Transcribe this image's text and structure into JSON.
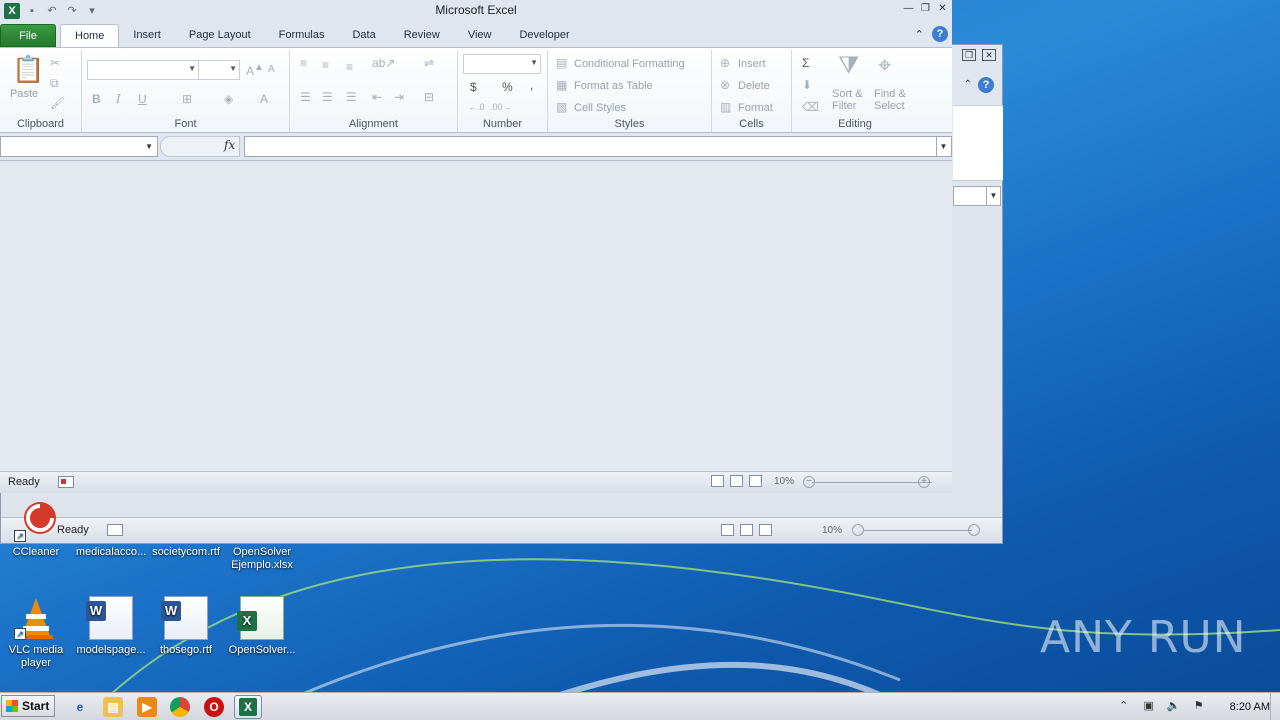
{
  "window": {
    "title": "Microsoft Excel"
  },
  "tabs": [
    "File",
    "Home",
    "Insert",
    "Page Layout",
    "Formulas",
    "Data",
    "Review",
    "View",
    "Developer"
  ],
  "ribbon": {
    "clipboard": {
      "paste": "Paste",
      "label": "Clipboard"
    },
    "font": {
      "label": "Font",
      "bold": "B",
      "italic": "I",
      "underline": "U"
    },
    "alignment": {
      "label": "Alignment"
    },
    "number": {
      "label": "Number",
      "currency": "$",
      "percent": "%",
      "comma": ","
    },
    "styles": {
      "label": "Styles",
      "conditional": "Conditional Formatting",
      "format_table": "Format as Table",
      "cell_styles": "Cell Styles"
    },
    "cells": {
      "label": "Cells",
      "insert": "Insert",
      "delete": "Delete",
      "format": "Format"
    },
    "editing": {
      "label": "Editing",
      "sort1": "Sort &",
      "sort2": "Filter",
      "find1": "Find &",
      "find2": "Select",
      "sigma": "Σ"
    }
  },
  "formula_bar": {
    "fx": "fx",
    "name_value": "",
    "formula_value": ""
  },
  "status": {
    "ready": "Ready",
    "zoom": "10%"
  },
  "back_window": {
    "ready": "Ready",
    "zoom": "10%"
  },
  "desktop_icons": [
    {
      "label": "CCleaner"
    },
    {
      "label": "medicalacco..."
    },
    {
      "label": "societycom.rtf"
    },
    {
      "label": "OpenSolver Ejemplo.xlsx"
    },
    {
      "label": "VLC media player"
    },
    {
      "label": "modelspage..."
    },
    {
      "label": "thosego.rtf"
    },
    {
      "label": "OpenSolver..."
    }
  ],
  "taskbar": {
    "start": "Start",
    "clock": "8:20 AM"
  },
  "watermark": "ANY RUN"
}
